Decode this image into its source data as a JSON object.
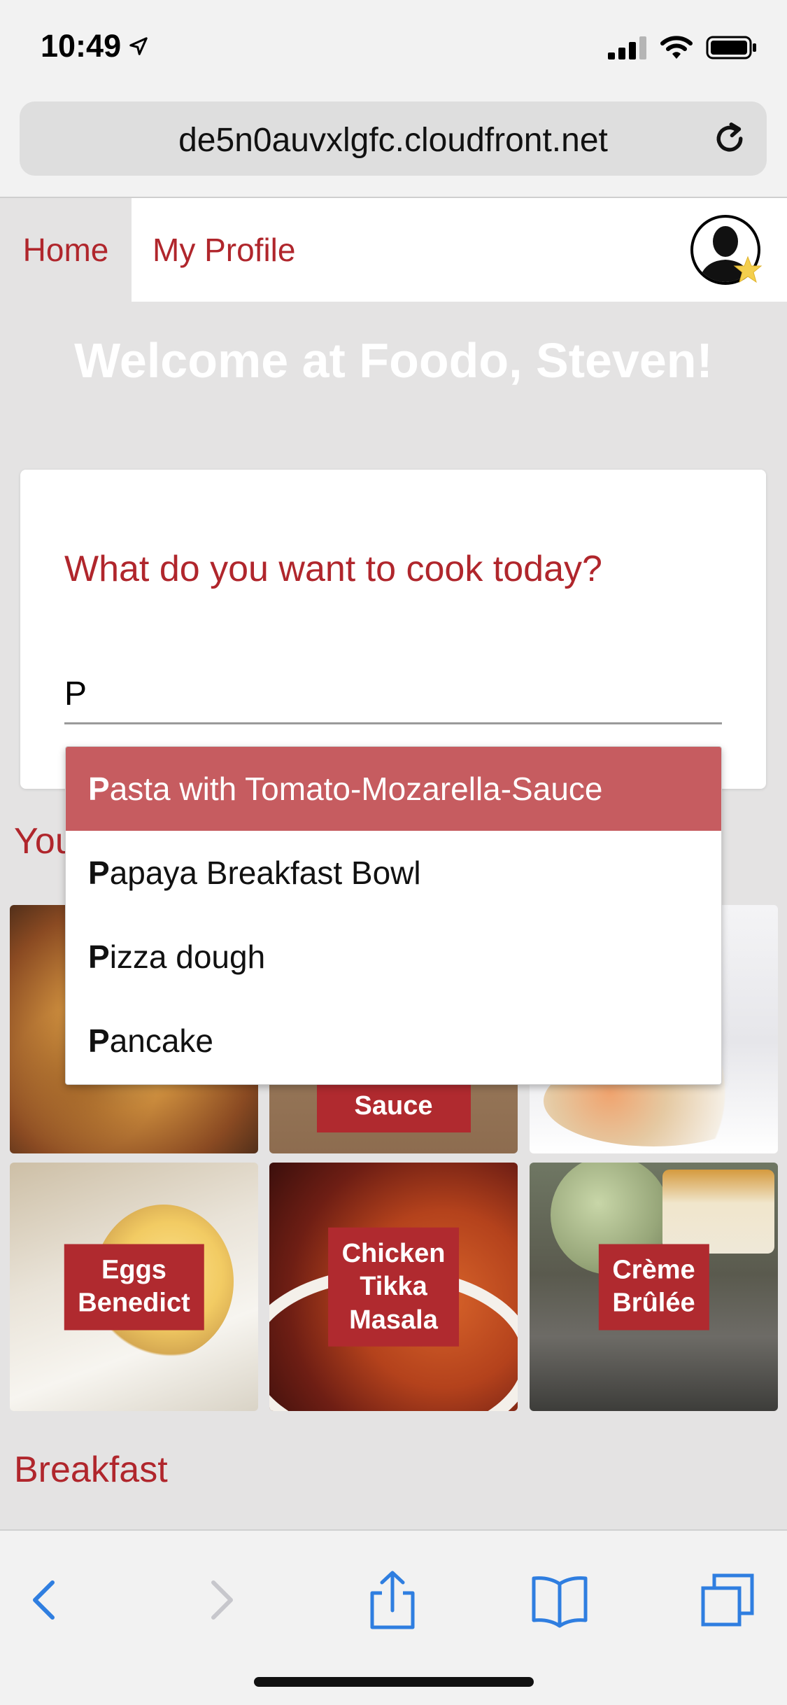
{
  "status": {
    "time": "10:49"
  },
  "browser": {
    "url": "de5n0auvxlgfc.cloudfront.net"
  },
  "nav": {
    "home": "Home",
    "profile": "My Profile"
  },
  "welcome": "Welcome at Foodo, Steven!",
  "search": {
    "question": "What do you want to cook today?",
    "value": "P"
  },
  "autocomplete": [
    {
      "match": "P",
      "rest": "asta with Tomato-Mozarella-Sauce"
    },
    {
      "match": "P",
      "rest": "apaya Breakfast Bowl"
    },
    {
      "match": "P",
      "rest": "izza dough"
    },
    {
      "match": "P",
      "rest": "ancake"
    }
  ],
  "sections": {
    "partial": "You",
    "breakfast": "Breakfast"
  },
  "tiles_row1": [
    {
      "label": ""
    },
    {
      "label": "Sauce"
    },
    {
      "label": ""
    }
  ],
  "tiles_row2": [
    {
      "label": "Eggs\nBenedict"
    },
    {
      "label": "Chicken\nTikka\nMasala"
    },
    {
      "label": "Crème\nBrûlée"
    }
  ],
  "colors": {
    "accent": "#b0262c",
    "highlight": "#c65c60",
    "ios_blue": "#2f7ee0"
  }
}
